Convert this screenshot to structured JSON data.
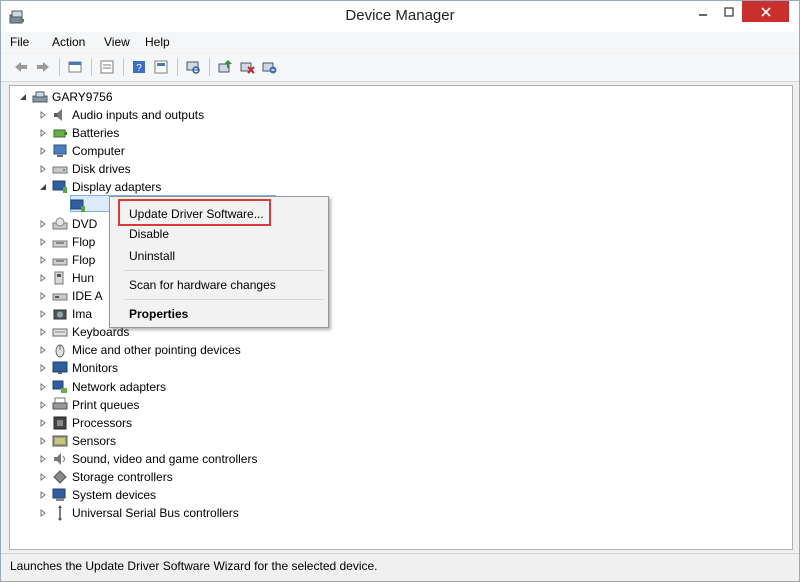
{
  "window": {
    "title": "Device Manager"
  },
  "menu": [
    "File",
    "Action",
    "View",
    "Help"
  ],
  "toolbar": [
    "back",
    "forward",
    "up",
    "show-hide",
    "help",
    "properties",
    "scan",
    "update-driver",
    "disable",
    "uninstall"
  ],
  "tree": {
    "root": "GARY9756",
    "items": [
      {
        "label": "Audio inputs and outputs",
        "icon": "speaker-icon",
        "expanded": false
      },
      {
        "label": "Batteries",
        "icon": "battery-icon",
        "expanded": false
      },
      {
        "label": "Computer",
        "icon": "computer-icon",
        "expanded": false
      },
      {
        "label": "Disk drives",
        "icon": "disk-icon",
        "expanded": false
      },
      {
        "label": "Display adapters",
        "icon": "display-icon",
        "expanded": true
      },
      {
        "label": "",
        "icon": "display-adapter-icon",
        "expanded": null,
        "child": true
      },
      {
        "label": "DVD",
        "icon": "dvd-icon",
        "expanded": false
      },
      {
        "label": "Flop",
        "icon": "floppy-icon",
        "expanded": false
      },
      {
        "label": "Flop",
        "icon": "floppy-icon",
        "expanded": false
      },
      {
        "label": "Hun",
        "icon": "hid-icon",
        "expanded": false
      },
      {
        "label": "IDE A",
        "icon": "ide-icon",
        "expanded": false
      },
      {
        "label": "Ima",
        "icon": "imaging-icon",
        "expanded": false
      },
      {
        "label": "Keyboards",
        "icon": "keyboard-icon",
        "expanded": false
      },
      {
        "label": "Mice and other pointing devices",
        "icon": "mouse-icon",
        "expanded": false
      },
      {
        "label": "Monitors",
        "icon": "monitor-icon",
        "expanded": false
      },
      {
        "label": "Network adapters",
        "icon": "network-icon",
        "expanded": false
      },
      {
        "label": "Print queues",
        "icon": "printer-icon",
        "expanded": false
      },
      {
        "label": "Processors",
        "icon": "processor-icon",
        "expanded": false
      },
      {
        "label": "Sensors",
        "icon": "sensor-icon",
        "expanded": false
      },
      {
        "label": "Sound, video and game controllers",
        "icon": "sound-icon",
        "expanded": false
      },
      {
        "label": "Storage controllers",
        "icon": "storage-icon",
        "expanded": false
      },
      {
        "label": "System devices",
        "icon": "system-icon",
        "expanded": false
      },
      {
        "label": "Universal Serial Bus controllers",
        "icon": "usb-icon",
        "expanded": false
      }
    ]
  },
  "context_menu": {
    "update_driver": "Update Driver Software...",
    "disable": "Disable",
    "uninstall": "Uninstall",
    "scan": "Scan for hardware changes",
    "properties": "Properties"
  },
  "status": "Launches the Update Driver Software Wizard for the selected device.",
  "colors": {
    "accent": "#d9393b",
    "selection": "#dcebfc",
    "close": "#c9302c"
  }
}
